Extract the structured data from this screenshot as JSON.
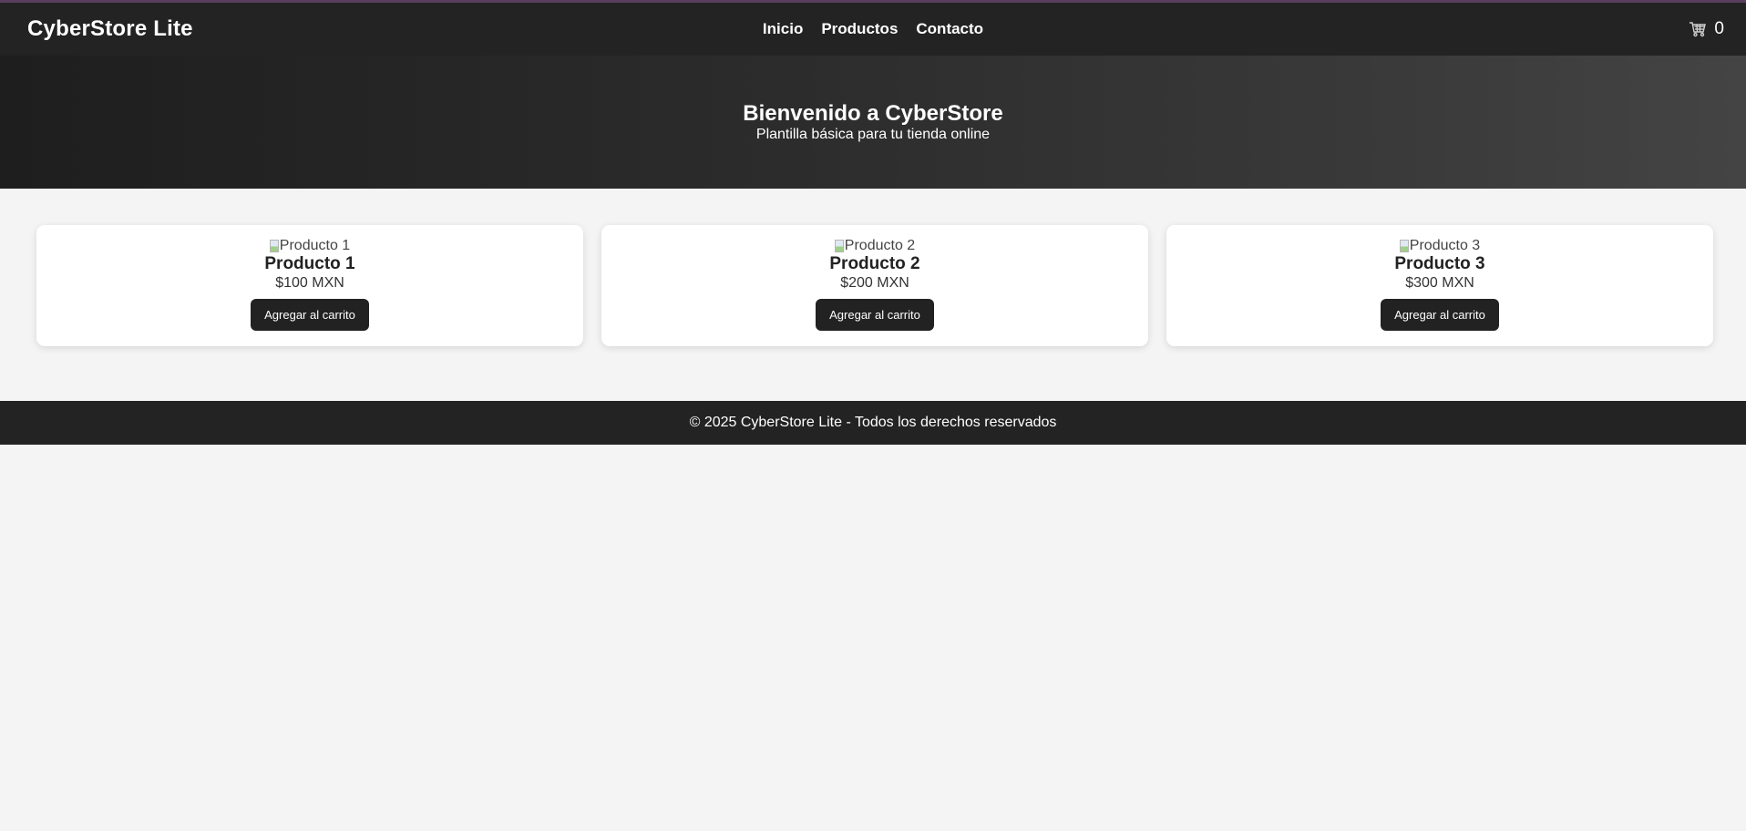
{
  "navbar": {
    "brand": "CyberStore Lite",
    "links": [
      {
        "label": "Inicio"
      },
      {
        "label": "Productos"
      },
      {
        "label": "Contacto"
      }
    ],
    "cart": {
      "icon": "cart-icon",
      "count": "0"
    }
  },
  "hero": {
    "title": "Bienvenido a CyberStore",
    "subtitle": "Plantilla básica para tu tienda online"
  },
  "products": [
    {
      "img_alt": "Producto 1",
      "name": "Producto 1",
      "price": "$100 MXN",
      "button_label": "Agregar al carrito"
    },
    {
      "img_alt": "Producto 2",
      "name": "Producto 2",
      "price": "$200 MXN",
      "button_label": "Agregar al carrito"
    },
    {
      "img_alt": "Producto 3",
      "name": "Producto 3",
      "price": "$300 MXN",
      "button_label": "Agregar al carrito"
    }
  ],
  "footer": {
    "text": "© 2025 CyberStore Lite - Todos los derechos reservados"
  },
  "colors": {
    "navbar_bg": "#232323",
    "page_bg": "#f4f4f4",
    "button_bg": "#222222",
    "top_border": "#5a3e5e"
  }
}
